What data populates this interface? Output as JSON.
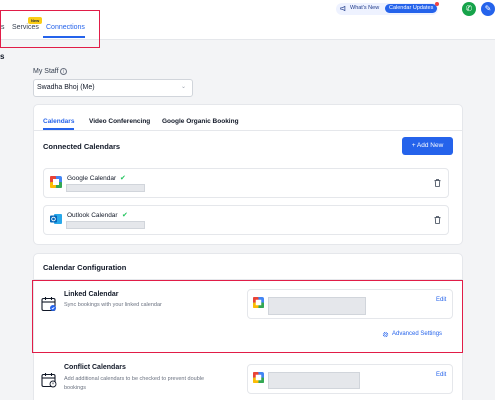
{
  "topnav": {
    "items": [
      {
        "label": "s"
      },
      {
        "label": "Services",
        "badge": "New"
      },
      {
        "label": "Connections"
      }
    ],
    "whats_new_label": "What's New",
    "calendar_updates_label": "Calendar Updates"
  },
  "page": {
    "edge_letter": "s",
    "my_staff_label": "My Staff",
    "info_glyph": "i",
    "staff_selected": "Swadha Bhoj (Me)"
  },
  "tabs": [
    {
      "label": "Calendars",
      "active": true
    },
    {
      "label": "Video Conferencing",
      "active": false
    },
    {
      "label": "Google Organic Booking",
      "active": false
    }
  ],
  "connected": {
    "title": "Connected Calendars",
    "add_new_label": "+ Add New",
    "items": [
      {
        "name": "Google Calendar",
        "icon": "google-calendar-icon",
        "verified": true
      },
      {
        "name": "Outlook Calendar",
        "icon": "outlook-calendar-icon",
        "verified": true
      }
    ]
  },
  "config": {
    "title": "Calendar Configuration",
    "linked": {
      "title": "Linked Calendar",
      "subtitle": "Sync bookings with your linked calendar",
      "edit_label": "Edit",
      "advanced_label": "Advanced Settings"
    },
    "conflict": {
      "title": "Conflict Calendars",
      "subtitle_line1": "Add additional calendars to be checked to prevent double",
      "subtitle_line2": "bookings",
      "edit_label": "Edit"
    }
  },
  "colors": {
    "accent": "#2563eb",
    "highlight": "#e11d48",
    "success": "#22c55e",
    "badge": "#facc15"
  }
}
